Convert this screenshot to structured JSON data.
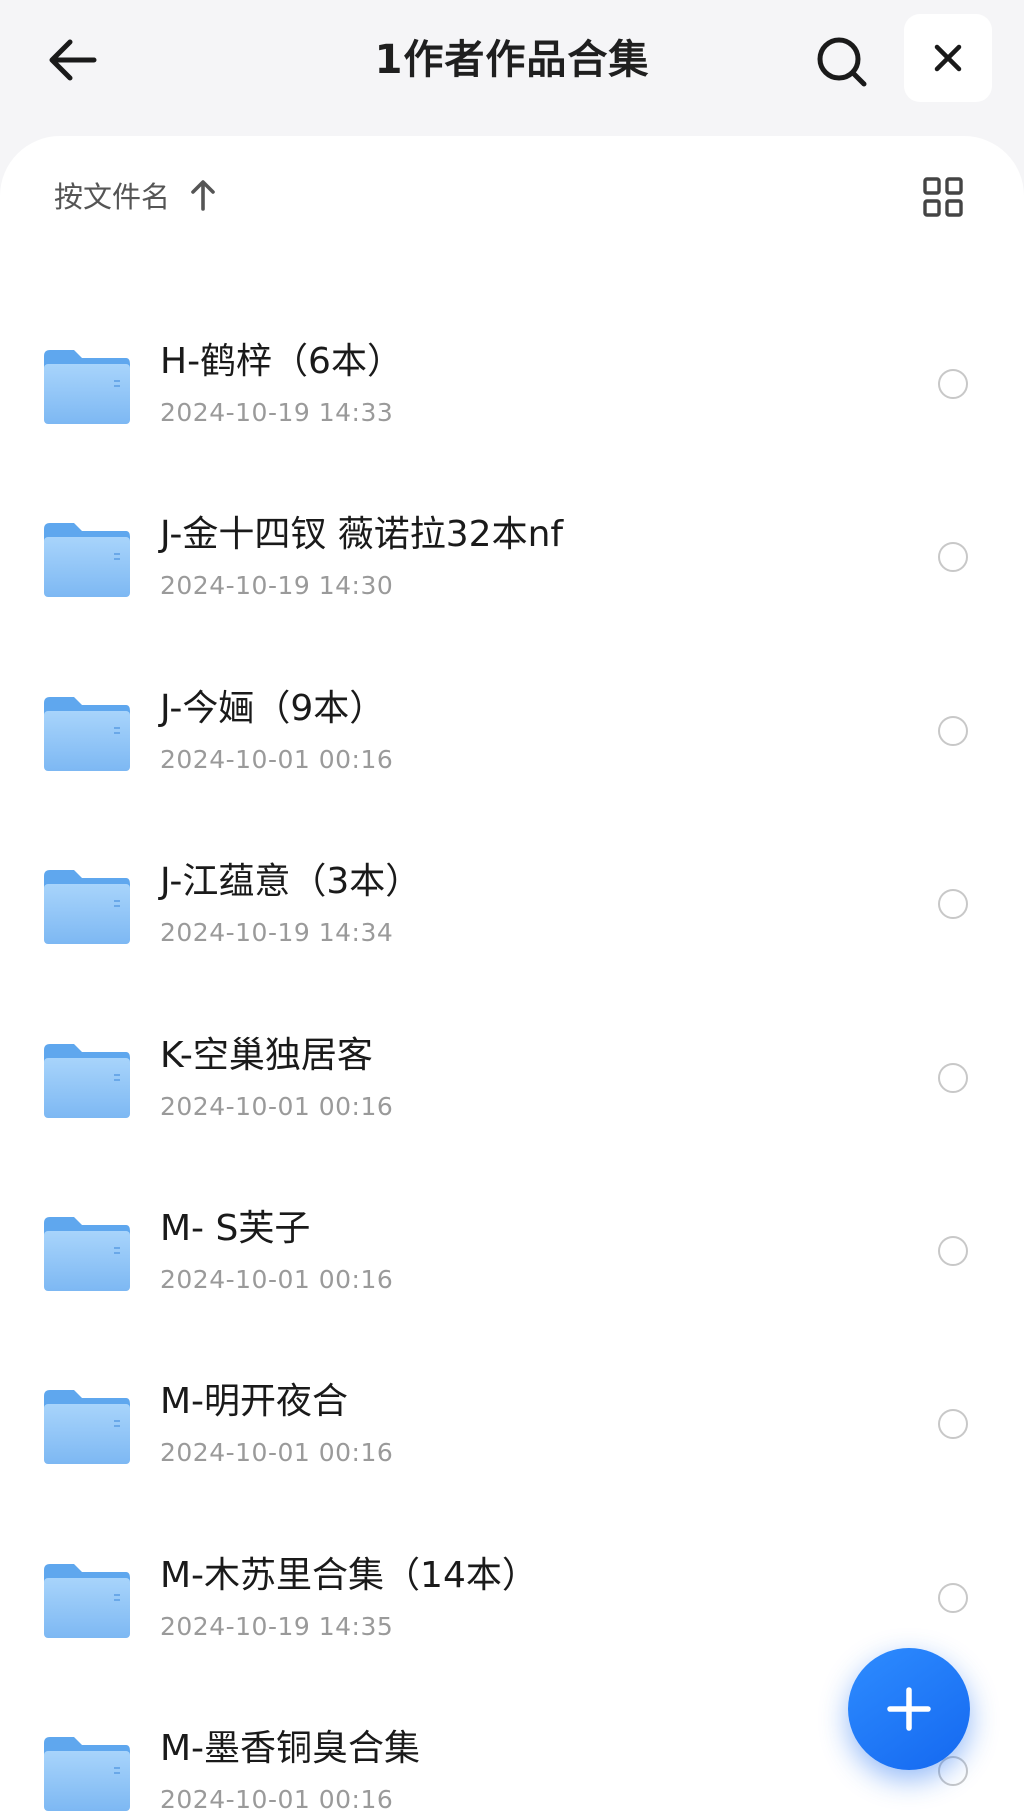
{
  "header": {
    "title": "1作者作品合集",
    "back_icon": "arrow-left-icon",
    "search_icon": "search-icon",
    "close_icon": "close-icon"
  },
  "toolbar": {
    "sort_label": "按文件名",
    "sort_icon": "arrow-up-icon",
    "view_icon": "grid-view-icon"
  },
  "files": [
    {
      "name": "H-鹤梓（6本）",
      "date": "2024-10-19 14:33"
    },
    {
      "name": "J-金十四钗 薇诺拉32本nf",
      "date": "2024-10-19 14:30"
    },
    {
      "name": "J-今婳（9本）",
      "date": "2024-10-01 00:16"
    },
    {
      "name": "J-江蕴意（3本）",
      "date": "2024-10-19 14:34"
    },
    {
      "name": "K-空巢独居客",
      "date": "2024-10-01 00:16"
    },
    {
      "name": "M- S芙子",
      "date": "2024-10-01 00:16"
    },
    {
      "name": "M-明开夜合",
      "date": "2024-10-01 00:16"
    },
    {
      "name": "M-木苏里合集（14本）",
      "date": "2024-10-19 14:35"
    },
    {
      "name": "M-墨香铜臭合集",
      "date": "2024-10-01 00:16"
    }
  ],
  "fab": {
    "icon": "plus-icon"
  },
  "colors": {
    "accent": "#1a73f5",
    "folder": "#8ec5f7",
    "background": "#f5f5f7"
  }
}
